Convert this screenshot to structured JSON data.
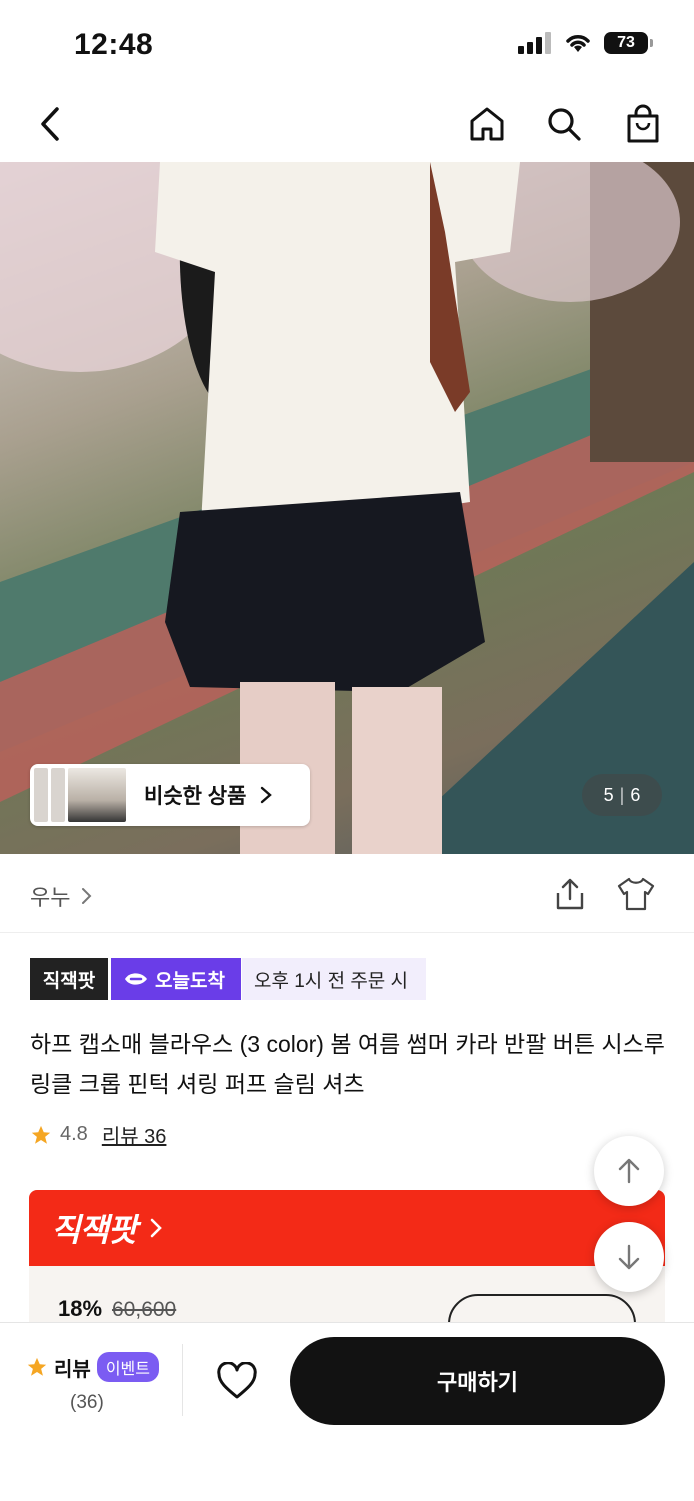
{
  "status": {
    "time": "12:48",
    "battery": "73"
  },
  "gallery": {
    "similar_label": "비슷한 상품",
    "current_page": "5",
    "separator": "|",
    "total_pages": "6"
  },
  "brand": {
    "name": "우누"
  },
  "badges": {
    "direct": "직잭팟",
    "today": "오늘도착",
    "order_note": "오후 1시 전 주문 시"
  },
  "product": {
    "title": "하프 캡소매 블라우스 (3 color) 봄 여름 썸머 카라 반팔 버튼 시스루 링클 크롭 핀턱 셔링 퍼프 슬림 셔츠",
    "rating": "4.8",
    "review_link": "리뷰 36"
  },
  "promo": {
    "title": "직잭팟",
    "discount": "18%",
    "original_price": "60,600"
  },
  "bottom": {
    "review_label": "리뷰",
    "event_label": "이벤트",
    "review_count": "(36)",
    "buy_label": "구매하기"
  },
  "colors": {
    "accent_red": "#f32a17",
    "accent_purple": "#6a3de8",
    "buy_black": "#121212",
    "star": "#f5a623"
  }
}
